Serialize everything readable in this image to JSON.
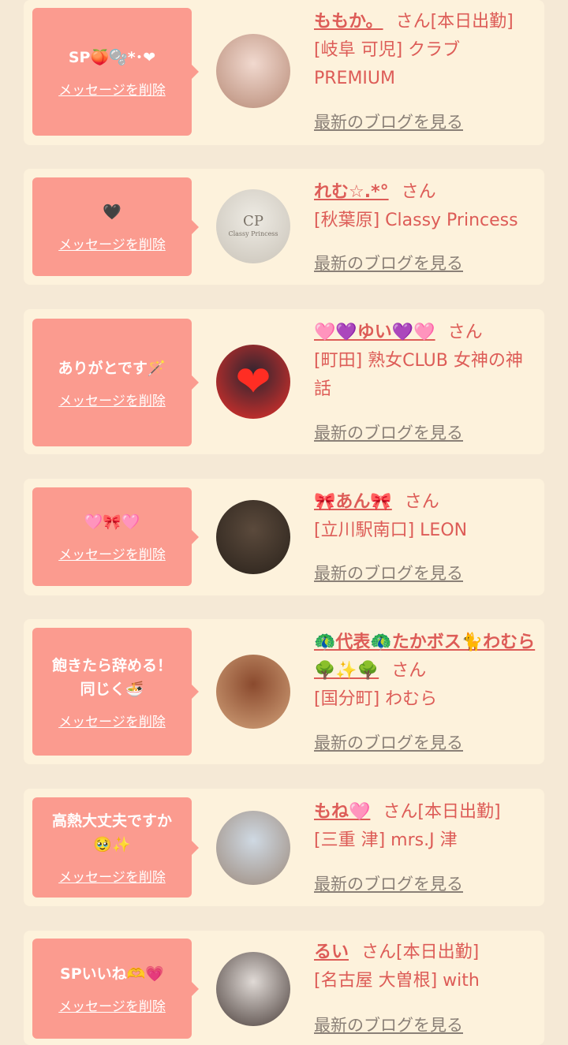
{
  "messages": [
    {
      "bubble_text": "SP🍑🫧*･❤",
      "delete_label": "メッセージを削除",
      "name": "ももか。",
      "suffix": "さん[本日出勤]",
      "shop": "[岐阜 可児] クラブPREMIUM",
      "blog_label": "最新のブログを見る",
      "avatar_icon": "woman-photo-avatar",
      "avatar_colors": [
        "#f1d9cf",
        "#b78a76"
      ]
    },
    {
      "bubble_text": "🖤",
      "delete_label": "メッセージを削除",
      "name": "れむ☆.*°",
      "suffix": "さん",
      "shop": "[秋葉原] Classy Princess",
      "blog_label": "最新のブログを見る",
      "avatar_icon": "shop-logo-avatar",
      "avatar_logo_text": "Classy Princess",
      "avatar_colors": [
        "#eeebe4",
        "#c9c3b8"
      ]
    },
    {
      "bubble_text": "ありがとです🪄",
      "delete_label": "メッセージを削除",
      "name": "🩷💜ゆい💜🩷",
      "suffix": "さん",
      "shop": "[町田] 熟女CLUB 女神の神話",
      "blog_label": "最新のブログを見る",
      "avatar_icon": "heart-photo-avatar",
      "avatar_colors": [
        "#2c2530",
        "#e8302a"
      ]
    },
    {
      "bubble_text": "🩷🎀🩷",
      "delete_label": "メッセージを削除",
      "name": "🎀あん🎀",
      "suffix": "さん",
      "shop": "[立川駅南口] LEON",
      "blog_label": "最新のブログを見る",
      "avatar_icon": "woman-photo-avatar",
      "avatar_colors": [
        "#5b4a3c",
        "#2a221b"
      ]
    },
    {
      "bubble_text": "飽きたら辞める！\n同じく🍜",
      "delete_label": "メッセージを削除",
      "name": "🦚代表🦚たかボス🐈わむら🌳✨🌳",
      "suffix": "さん",
      "shop": "[国分町] わむら",
      "blog_label": "最新のブログを見る",
      "avatar_icon": "face-photo-avatar",
      "avatar_colors": [
        "#8a4a2e",
        "#d2a27a"
      ]
    },
    {
      "bubble_text": "高熱大丈夫ですか\n🥹✨",
      "delete_label": "メッセージを削除",
      "name": "もね🩷",
      "suffix": "さん[本日出勤]",
      "shop": "[三重 津] mrs.J 津",
      "blog_label": "最新のブログを見る",
      "avatar_icon": "woman-photo-avatar",
      "avatar_colors": [
        "#cfd9e3",
        "#9c8a7c"
      ]
    },
    {
      "bubble_text": "SPいいね🫶💗",
      "delete_label": "メッセージを削除",
      "name": "るい",
      "suffix": "さん[本日出勤]",
      "shop": "[名古屋 大曽根] with",
      "blog_label": "最新のブログを見る",
      "avatar_icon": "woman-photo-avatar",
      "avatar_colors": [
        "#e0dad6",
        "#4a3e3a"
      ]
    }
  ]
}
